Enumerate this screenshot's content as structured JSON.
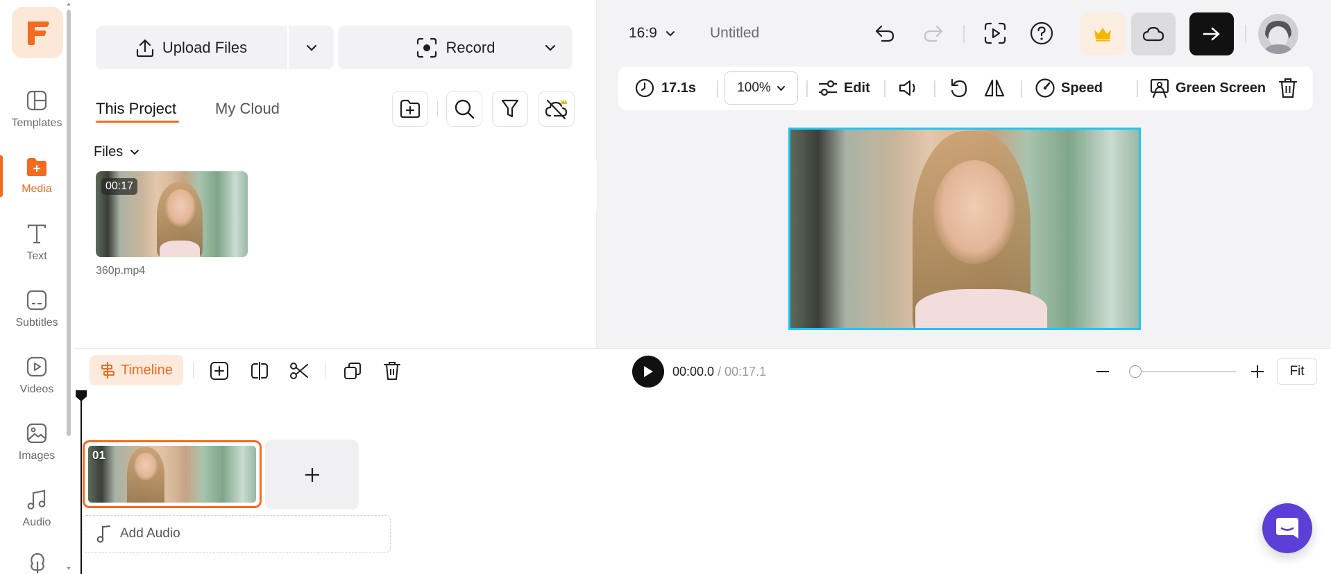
{
  "app": {
    "logo_letter": "F",
    "brand_color": "#f26b21"
  },
  "left_nav": {
    "items": [
      {
        "label": "Templates",
        "icon": "templates-icon"
      },
      {
        "label": "Media",
        "icon": "media-icon",
        "active": true
      },
      {
        "label": "Text",
        "icon": "text-icon"
      },
      {
        "label": "Subtitles",
        "icon": "subtitles-icon"
      },
      {
        "label": "Videos",
        "icon": "videos-icon"
      },
      {
        "label": "Images",
        "icon": "images-icon"
      },
      {
        "label": "Audio",
        "icon": "audio-icon"
      }
    ]
  },
  "media_panel": {
    "upload_label": "Upload Files",
    "record_label": "Record",
    "tabs": [
      {
        "label": "This Project",
        "active": true
      },
      {
        "label": "My Cloud"
      }
    ],
    "files_label": "Files",
    "files": [
      {
        "name": "360p.mp4",
        "duration": "00:17"
      }
    ]
  },
  "top_bar": {
    "aspect_ratio": "16:9",
    "project_title": "Untitled"
  },
  "clip_toolbar": {
    "duration": "17.1s",
    "zoom": "100%",
    "edit_label": "Edit",
    "speed_label": "Speed",
    "green_screen_label": "Green Screen"
  },
  "timeline": {
    "timeline_label": "Timeline",
    "current_time": "00:00.0",
    "separator": "/",
    "total_time": "00:17.1",
    "fit_label": "Fit",
    "clip_number": "01",
    "add_audio_label": "Add Audio"
  }
}
